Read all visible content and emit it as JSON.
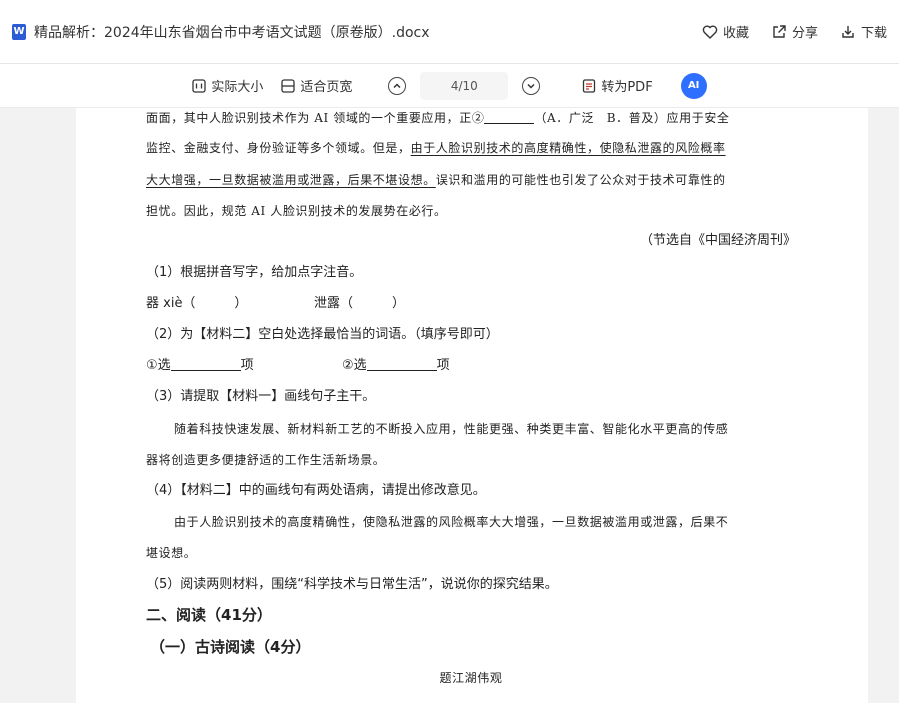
{
  "header": {
    "app_icon_letter": "W",
    "title": "精品解析：2024年山东省烟台市中考语文试题（原卷版）.docx",
    "actions": {
      "favorite": "收藏",
      "share": "分享",
      "download": "下载"
    }
  },
  "toolbar": {
    "actual_size": "实际大小",
    "fit_width": "适合页宽",
    "page_indicator": "4/10",
    "to_pdf": "转为PDF",
    "ai_label": "AI"
  },
  "doc": {
    "l1a": "面面，其中人脸识别技术作为 AI 领域的一个重要应用，正②",
    "l1b": "（A．广泛　B．普及）应用于安全",
    "l2a": "监控、金融支付、身份验证等多个领域。但是，",
    "l2u": "由于人脸识别技术的高度精确性，使隐私泄露的风险概率",
    "l3u": "大大增强，一旦数据被滥用或泄露，后果不堪设想。",
    "l3b": "误识和滥用的可能性也引发了公众对于技术可靠性的",
    "l4": "担忧。因此，规范 AI 人脸识别技术的发展势在必行。",
    "source": "（节选自《中国经济周刊》",
    "q1": "（1）根据拼音写字，给加点字注音。",
    "q1a": "器 xiè（　　　）",
    "q1b": "泄露（　　　）",
    "q2": "（2）为【材料二】空白处选择最恰当的词语。（填序号即可）",
    "q2a_pre": "①选",
    "q2a_post": "项",
    "q2b_pre": "②选",
    "q2b_post": "项",
    "q3": "（3）请提取【材料一】画线句子主干。",
    "q3s1": "随着科技快速发展、新材料新工艺的不断投入应用，性能更强、种类更丰富、智能化水平更高的传感",
    "q3s2": "器将创造更多便捷舒适的工作生活新场景。",
    "q4": "（4）【材料二】中的画线句有两处语病，请提出修改意见。",
    "q4s1": "由于人脸识别技术的高度精确性，使隐私泄露的风险概率大大增强，一旦数据被滥用或泄露，后果不",
    "q4s2": "堪设想。",
    "q5": "（5）阅读两则材料，围绕“科学技术与日常生活”，说说你的探究结果。",
    "sec2": "二、阅读（41分）",
    "sec2a": "（一）古诗阅读（4分）",
    "poem_title": "题江湖伟观"
  }
}
